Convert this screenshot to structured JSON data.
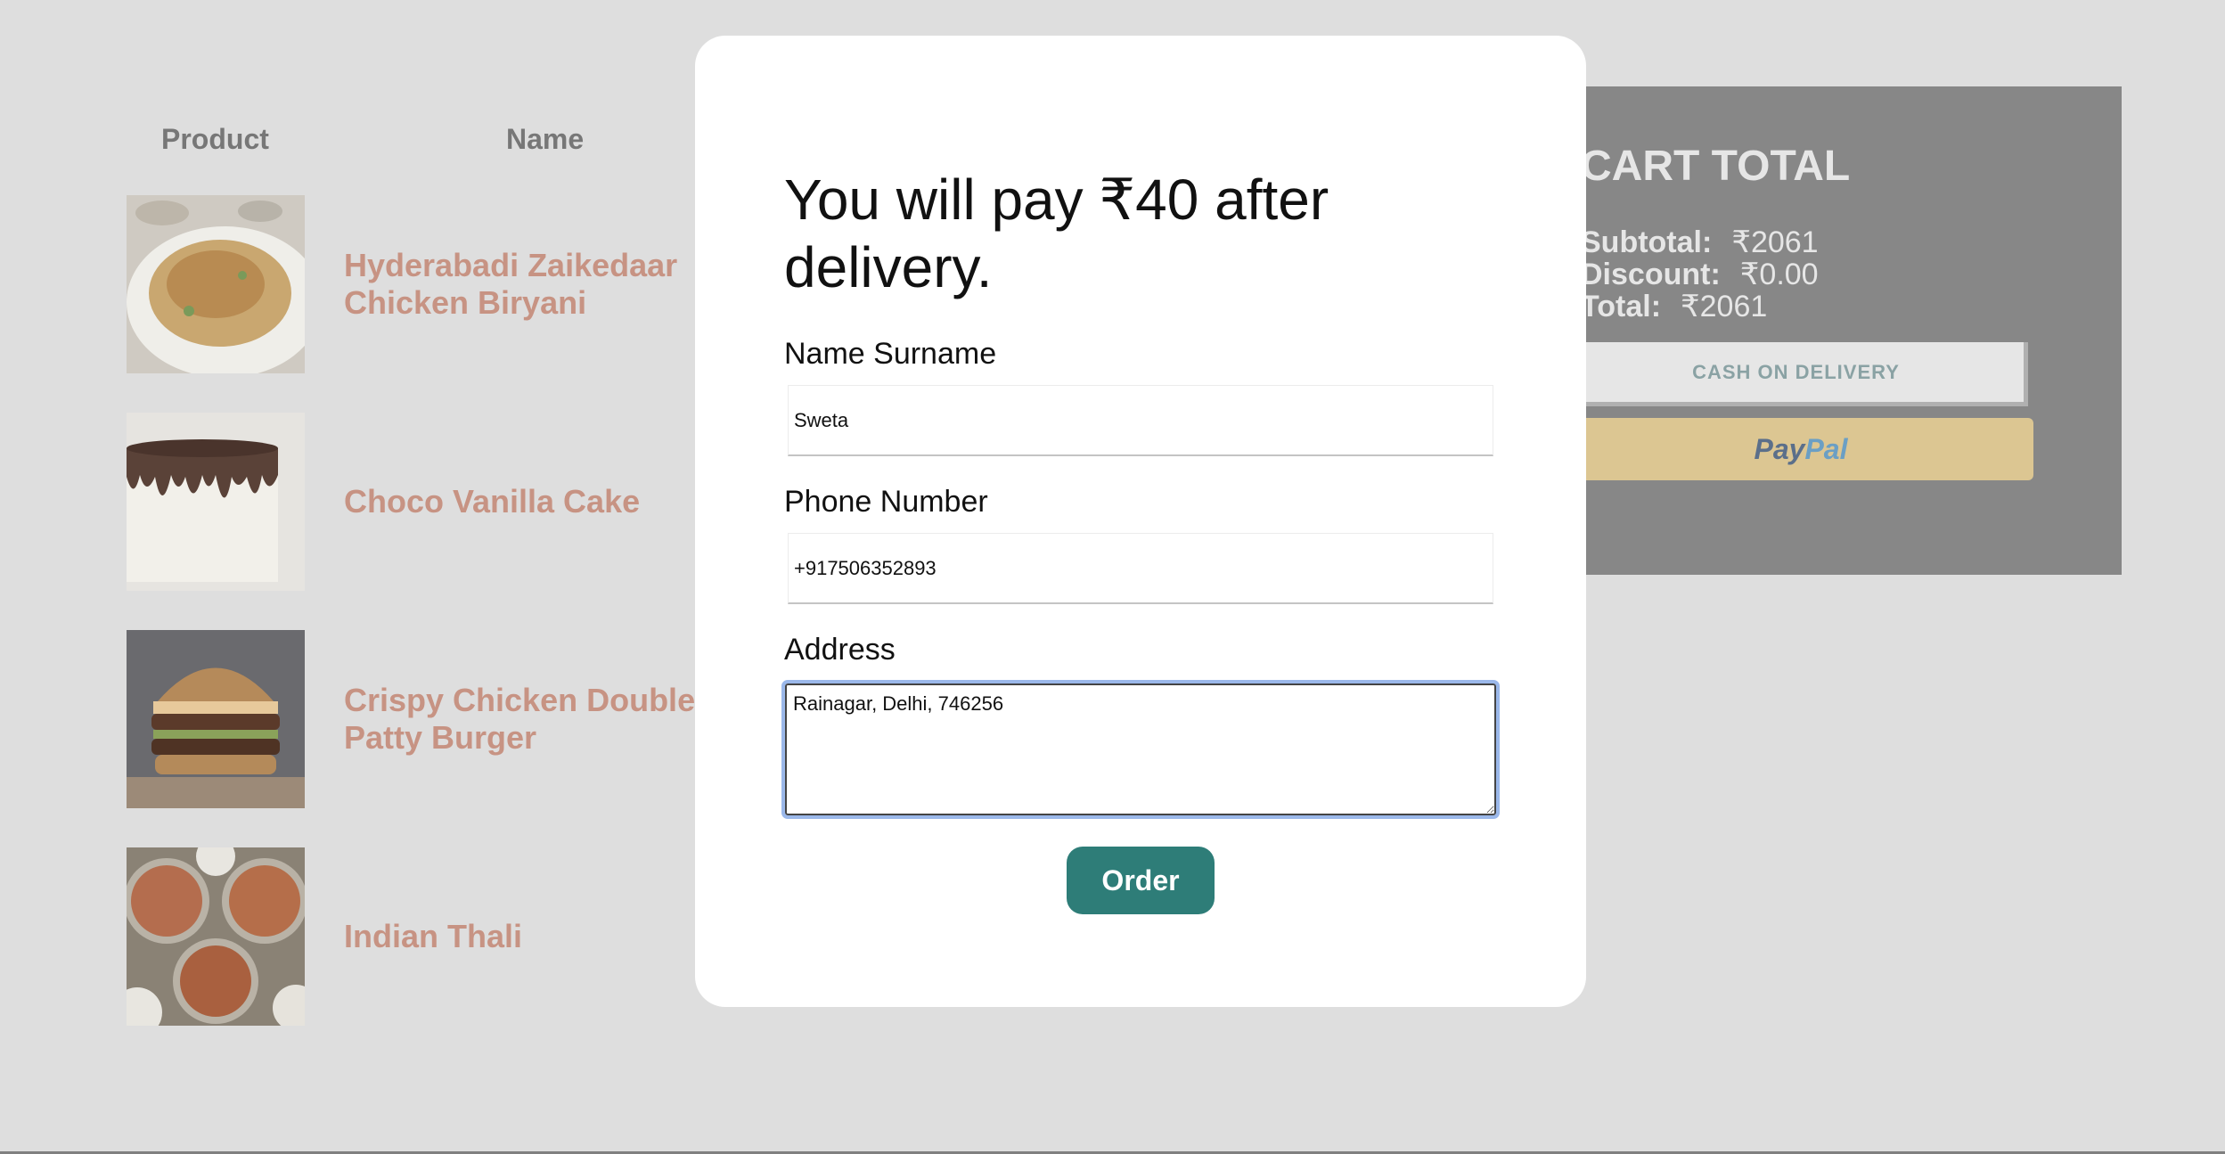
{
  "table": {
    "headers": {
      "product": "Product",
      "name": "Name"
    },
    "items": [
      {
        "name": "Hyderabadi Zaikedaar Chicken Biryani",
        "image": "biryani-image"
      },
      {
        "name": "Choco Vanilla Cake",
        "image": "cake-image"
      },
      {
        "name": "Crispy Chicken Double Patty Burger",
        "image": "burger-image"
      },
      {
        "name": "Indian Thali",
        "image": "thali-image"
      }
    ]
  },
  "cart_total": {
    "title": "CART TOTAL",
    "subtotal_label": "Subtotal:",
    "subtotal_value": "₹2061",
    "discount_label": "Discount:",
    "discount_value": "₹0.00",
    "total_label": "Total:",
    "total_value": "₹2061",
    "cod_button": "CASH ON DELIVERY",
    "paypal_part1": "Pay",
    "paypal_part2": "Pal"
  },
  "modal": {
    "title": "You will pay ₹40 after delivery.",
    "name_label": "Name Surname",
    "name_value": "Sweta",
    "phone_label": "Phone Number",
    "phone_value": "+917506352893",
    "address_label": "Address",
    "address_value": "Rainagar, Delhi, 746256",
    "order_button": "Order"
  },
  "colors": {
    "overlay_background": "#dedede",
    "product_name": "#c79383",
    "cart_panel": "#878787",
    "order_button": "#2e7d78",
    "paypal_button": "#dcc692",
    "focus_ring": "#9bb8ea"
  }
}
